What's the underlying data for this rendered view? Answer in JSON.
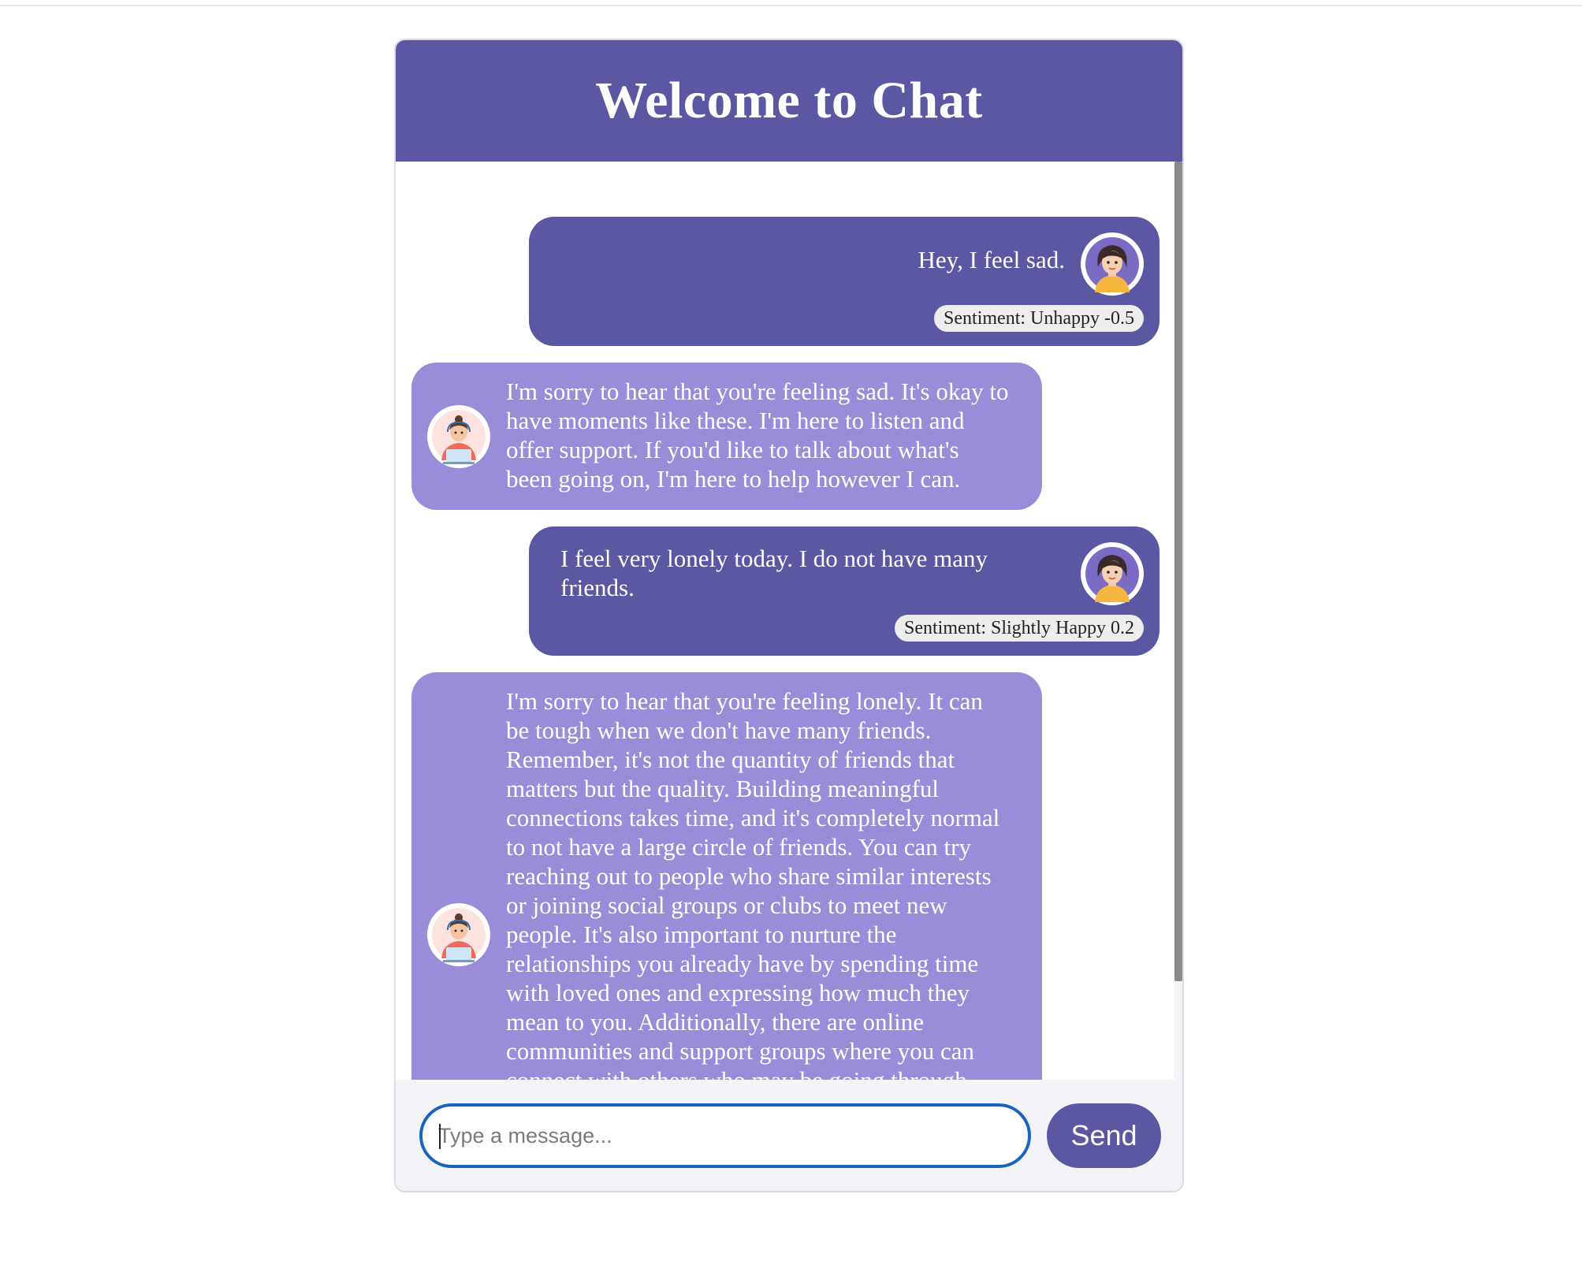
{
  "header": {
    "title": "Welcome to Chat"
  },
  "messages": [
    {
      "role": "user",
      "text": "Hey, I feel sad.",
      "sentiment": "Sentiment: Unhappy -0.5",
      "avatar_icon": "user-woman-avatar"
    },
    {
      "role": "bot",
      "text": "I'm sorry to hear that you're feeling sad. It's okay to have moments like these. I'm here to listen and offer support. If you'd like to talk about what's been going on, I'm here to help however I can.",
      "avatar_icon": "bot-assistant-avatar"
    },
    {
      "role": "user",
      "text": "I feel very lonely today. I do not have many friends.",
      "sentiment": "Sentiment: Slightly Happy 0.2",
      "avatar_icon": "user-woman-avatar"
    },
    {
      "role": "bot",
      "text": "I'm sorry to hear that you're feeling lonely. It can be tough when we don't have many friends. Remember, it's not the quantity of friends that matters but the quality. Building meaningful connections takes time, and it's completely normal to not have a large circle of friends. You can try reaching out to people who share similar interests or joining social groups or clubs to meet new people. It's also important to nurture the relationships you already have by spending time with loved ones and expressing how much they mean to you. Additionally, there are online communities and support groups where you can connect with others who may be going through similar experiences. Remember, you are not",
      "avatar_icon": "bot-assistant-avatar"
    }
  ],
  "composer": {
    "placeholder": "Type a message...",
    "value": "",
    "send_label": "Send"
  },
  "colors": {
    "header_bg": "#5b57a2",
    "user_bubble": "#5b57a2",
    "bot_bubble": "#9b8cd9",
    "input_focus_border": "#1a64c0"
  }
}
